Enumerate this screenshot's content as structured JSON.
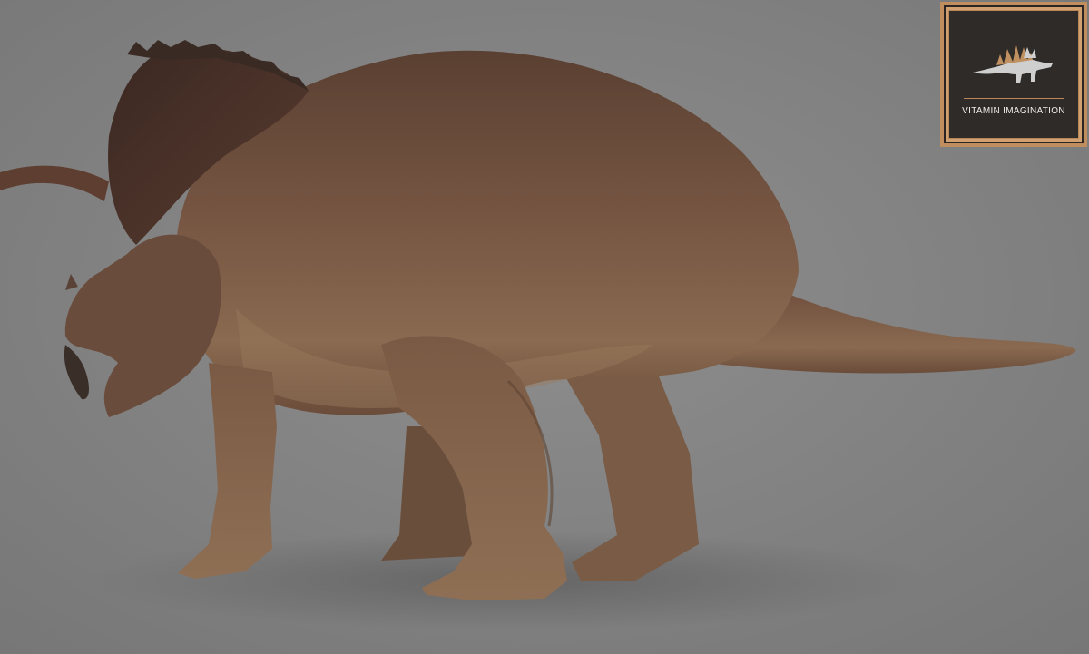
{
  "watermark": {
    "text": "VITAMIN IMAGINATION",
    "icon": "stegosaurus-icon",
    "frame_color": "#c08e5e",
    "panel_color": "#2e2b29"
  },
  "scene": {
    "subject": "triceratops-render",
    "background_color": "#858585",
    "skin_color": "#6e4e3a"
  }
}
